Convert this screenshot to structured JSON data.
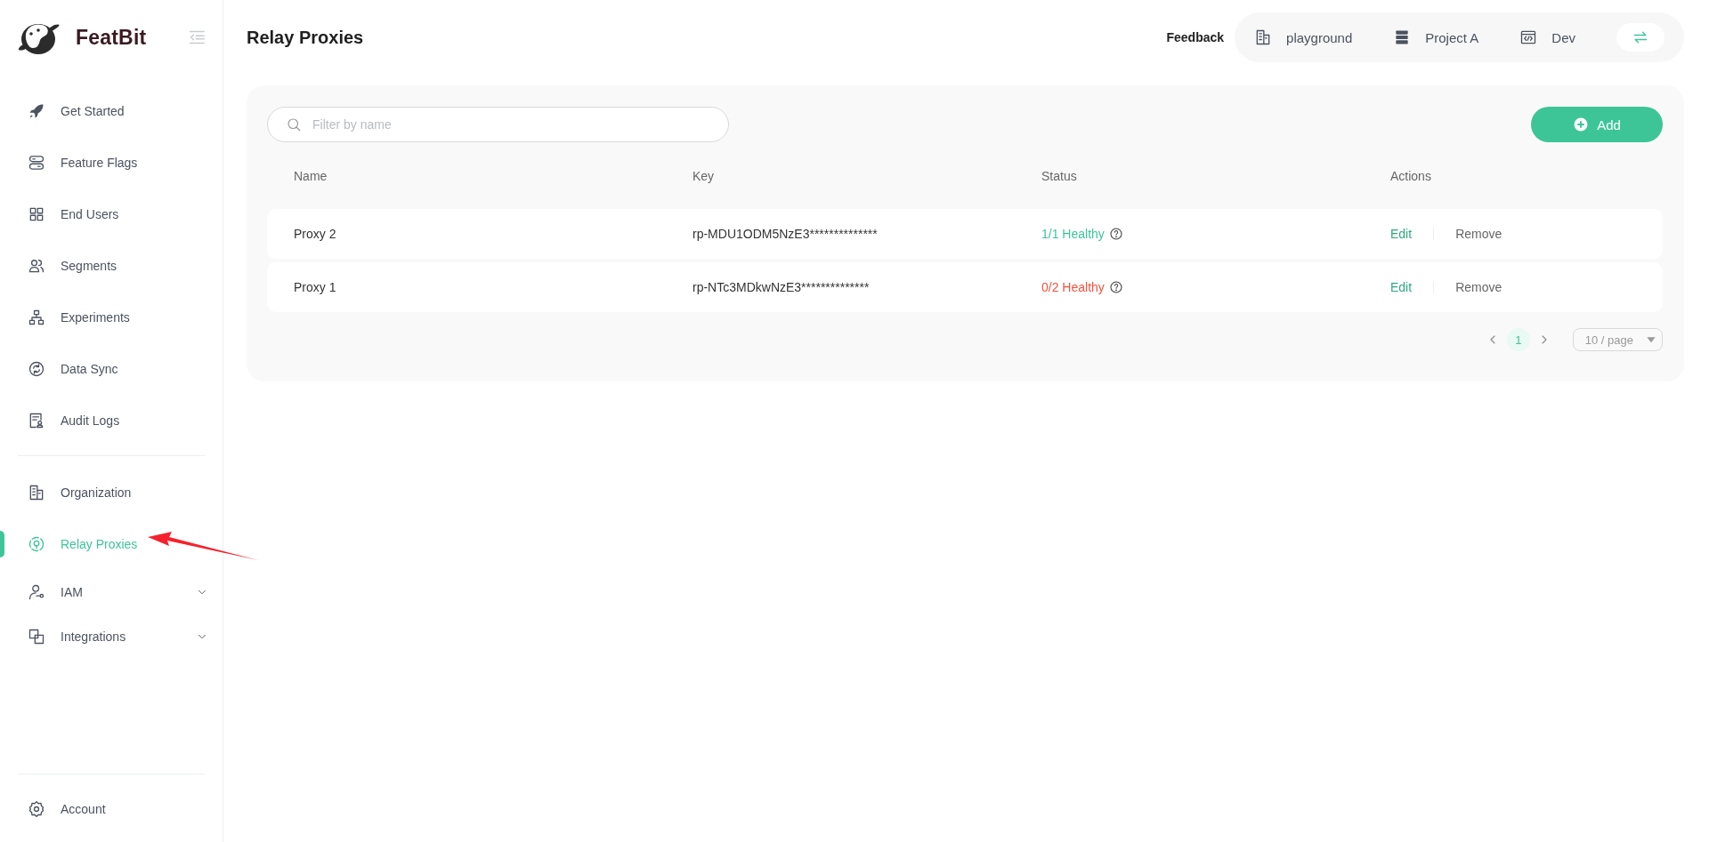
{
  "sidebar": {
    "brand": "FeatBit",
    "groups": [
      {
        "items": [
          {
            "label": "Get Started",
            "kind": "link",
            "selected": false
          },
          {
            "label": "Feature Flags",
            "kind": "link",
            "selected": false
          },
          {
            "label": "End Users",
            "kind": "link",
            "selected": false
          },
          {
            "label": "Segments",
            "kind": "link",
            "selected": false
          },
          {
            "label": "Experiments",
            "kind": "link",
            "selected": false
          },
          {
            "label": "Data Sync",
            "kind": "link",
            "selected": false
          },
          {
            "label": "Audit Logs",
            "kind": "link",
            "selected": false
          }
        ]
      },
      {
        "items": [
          {
            "label": "Organization",
            "kind": "link",
            "selected": false
          },
          {
            "label": "Relay Proxies",
            "kind": "link",
            "selected": true
          },
          {
            "label": "IAM",
            "kind": "expandable",
            "selected": false,
            "expanded": false
          },
          {
            "label": "Integrations",
            "kind": "expandable",
            "selected": false,
            "expanded": false
          }
        ]
      }
    ],
    "footer": {
      "label": "Account"
    }
  },
  "header": {
    "page_title": "Relay Proxies",
    "feedback": "Feedback",
    "context": [
      {
        "label": "playground"
      },
      {
        "label": "Project A"
      },
      {
        "label": "Dev"
      }
    ]
  },
  "panel": {
    "search": {
      "placeholder": "Filter by name"
    },
    "add_button": "Add",
    "table": {
      "columns": [
        "Name",
        "Key",
        "Status",
        "Actions"
      ],
      "rows": [
        {
          "name": "Proxy 2",
          "key": "rp-MDU1ODM5NzE3**************",
          "status": {
            "text": "1/1 Healthy",
            "color": "#3ec597"
          },
          "actions": [
            "Edit",
            "Remove"
          ]
        },
        {
          "name": "Proxy 1",
          "key": "rp-NTc3MDkwNzE3**************",
          "status": {
            "text": "0/2 Healthy",
            "color": "#f5533d"
          },
          "actions": [
            "Edit",
            "Remove"
          ]
        }
      ]
    },
    "pagination": {
      "pages": [
        {
          "label": "1",
          "selected": true
        }
      ],
      "page_size": "10 / page"
    }
  }
}
